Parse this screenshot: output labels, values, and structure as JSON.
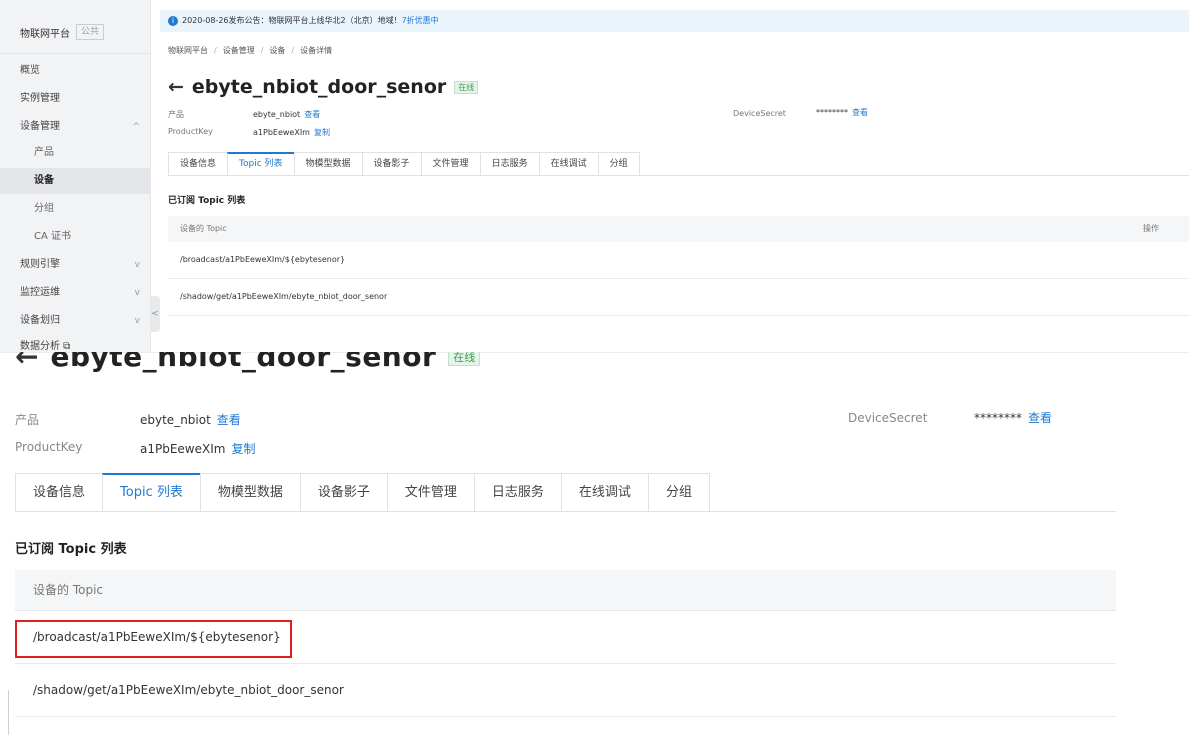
{
  "sidebar": {
    "brand": "物联网平台",
    "brand_tag": "公共",
    "items": [
      {
        "label": "概览",
        "chevron": ""
      },
      {
        "label": "实例管理",
        "chevron": ""
      },
      {
        "label": "设备管理",
        "chevron": "^"
      },
      {
        "label": "产品",
        "chevron": ""
      },
      {
        "label": "设备",
        "chevron": ""
      },
      {
        "label": "分组",
        "chevron": ""
      },
      {
        "label": "CA 证书",
        "chevron": ""
      },
      {
        "label": "规则引擎",
        "chevron": "v"
      },
      {
        "label": "监控运维",
        "chevron": "v"
      },
      {
        "label": "设备划归",
        "chevron": "v"
      },
      {
        "label": "数据分析 ⧉",
        "chevron": ""
      }
    ],
    "collapse_glyph": "<"
  },
  "notice": {
    "icon": "info-icon",
    "text": "2020-08-26发布公告：物联网平台上线华北2（北京）地域！",
    "promo": "7折优惠中"
  },
  "breadcrumb": [
    "物联网平台",
    "设备管理",
    "设备",
    "设备详情"
  ],
  "device": {
    "back_glyph": "←",
    "name": "ebyte_nbiot_door_senor",
    "status": "在线",
    "product_label": "产品",
    "product_value": "ebyte_nbiot",
    "view_link": "查看",
    "productkey_label": "ProductKey",
    "productkey_value": "a1PbEeweXIm",
    "copy_link": "复制",
    "secret_label": "DeviceSecret",
    "secret_value": "********",
    "secret_link": "查看"
  },
  "tabs": [
    "设备信息",
    "Topic 列表",
    "物模型数据",
    "设备影子",
    "文件管理",
    "日志服务",
    "在线调试",
    "分组"
  ],
  "topic_section": {
    "title": "已订阅 Topic 列表",
    "col_topic": "设备的 Topic",
    "col_action": "操作",
    "rows": [
      "/broadcast/a1PbEeweXIm/${ebytesenor}",
      "/shadow/get/a1PbEeweXIm/ebyte_nbiot_door_senor"
    ]
  }
}
